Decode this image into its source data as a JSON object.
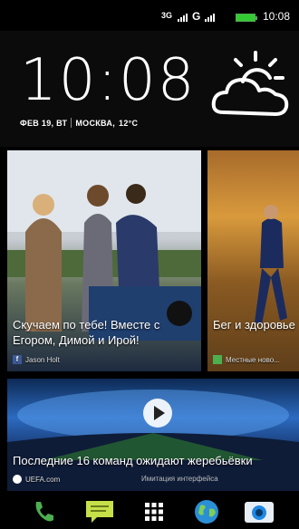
{
  "status_bar": {
    "network_1": "3G",
    "network_2": "G",
    "time": "10:08",
    "battery_color": "#33cc33"
  },
  "clock_widget": {
    "time": "10:08",
    "date": "ФЕВ 19, ВТ",
    "city": "МОСКВА,",
    "temperature": "12°C",
    "weather_icon": "sun-behind-cloud-icon"
  },
  "tiles": [
    {
      "title": "Скучаем по тебе! Вместе с Егором, Димой и Ирой!",
      "source": "Jason Holt",
      "source_icon": "facebook-icon"
    },
    {
      "title": "Бег и здоровье",
      "source": "Местные ново...",
      "source_icon": "news-icon"
    },
    {
      "title": "Последние 16 команд ожидают жеребьёвки",
      "source": "UEFA.com",
      "source_icon": "uefa-icon",
      "overlay_note": "Имитация интерфейса"
    }
  ],
  "dock": [
    {
      "icon": "phone-icon",
      "color": "#4caf50"
    },
    {
      "icon": "messages-icon",
      "color": "#c6e04a"
    },
    {
      "icon": "apps-grid-icon",
      "color": "#ffffff"
    },
    {
      "icon": "browser-globe-icon",
      "color": "#2b8fd6"
    },
    {
      "icon": "camera-icon",
      "color": "#1e88e5"
    }
  ]
}
